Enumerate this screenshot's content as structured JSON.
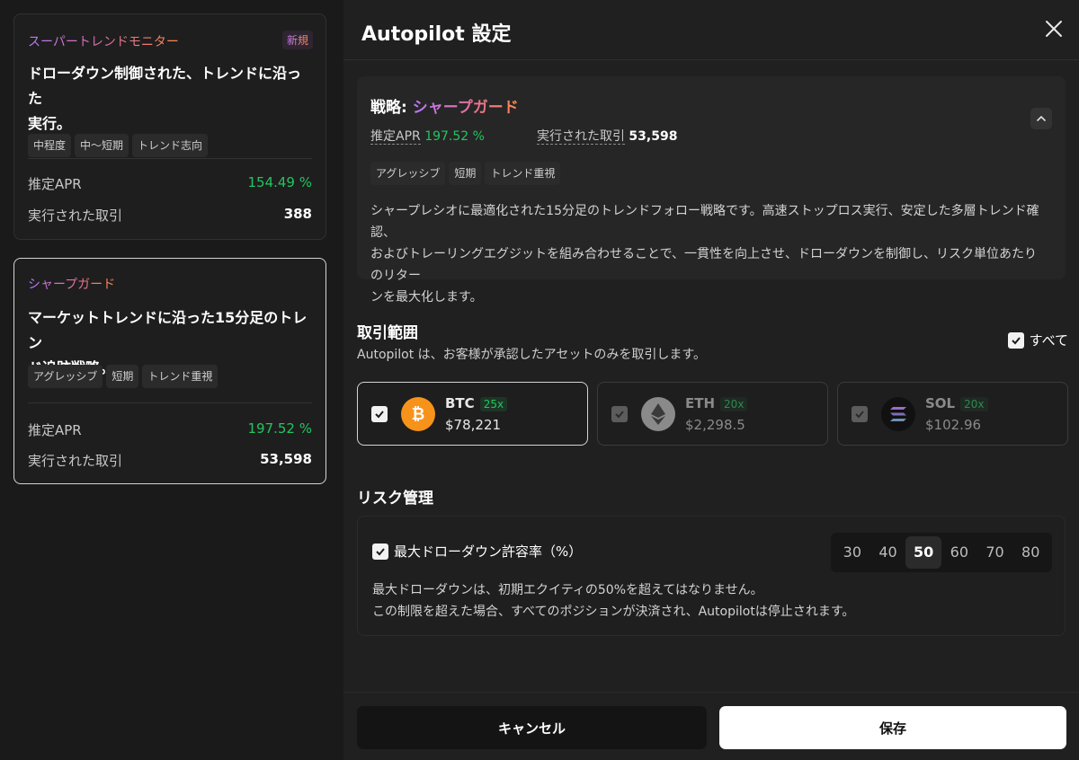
{
  "cards": [
    {
      "name": "スーパートレンドモニター",
      "badge": "新規",
      "desc_line1": "ドローダウン制御された、トレンドに沿った",
      "desc_line2": "実行。",
      "tags": [
        "中程度",
        "中〜短期",
        "トレンド志向"
      ],
      "apr_label": "推定APR",
      "apr_value": "154.49 %",
      "trades_label": "実行された取引",
      "trades_value": "388"
    },
    {
      "name": "シャープガード",
      "desc_line1": "マーケットトレンドに沿った15分足のトレン",
      "desc_line2": "ド追跡戦略。",
      "tags": [
        "アグレッシブ",
        "短期",
        "トレンド重視"
      ],
      "apr_label": "推定APR",
      "apr_value": "197.52 %",
      "trades_label": "実行された取引",
      "trades_value": "53,598"
    }
  ],
  "panel": {
    "title": "Autopilot 設定",
    "strategy": {
      "prefix": "戦略: ",
      "name": "シャープガード",
      "apr_label": "推定APR",
      "apr_value": "197.52 %",
      "trades_label": "実行された取引",
      "trades_value": "53,598",
      "tags": [
        "アグレッシブ",
        "短期",
        "トレンド重視"
      ],
      "line1": "シャープレシオに最適化された15分足のトレンドフォロー戦略です。高速ストップロス実行、安定した多層トレンド確認、",
      "line2": "およびトレーリングエグジットを組み合わせることで、一貫性を向上させ、ドローダウンを制御し、リスク単位あたりのリター",
      "line3": "ンを最大化します。"
    },
    "scope": {
      "title": "取引範囲",
      "subtitle": "Autopilot は、お客様が承認したアセットのみを取引します。",
      "all_label": "すべて",
      "assets": [
        {
          "symbol": "BTC",
          "leverage": "25x",
          "price": "$78,221",
          "icon": "bitcoin-icon",
          "color": "#f7931a"
        },
        {
          "symbol": "ETH",
          "leverage": "20x",
          "price": "$2,298.5",
          "icon": "ethereum-icon",
          "color": "#8a8a8a"
        },
        {
          "symbol": "SOL",
          "leverage": "20x",
          "price": "$102.96",
          "icon": "solana-icon",
          "color": "#111111"
        }
      ]
    },
    "risk": {
      "title": "リスク管理",
      "check_label": "最大ドローダウン許容率（%）",
      "options": [
        "30",
        "40",
        "50",
        "60",
        "70",
        "80"
      ],
      "selected": "50",
      "line1": "最大ドローダウンは、初期エクイティの50%を超えてはなりません。",
      "line2": "この制限を超えた場合、すべてのポジションが決済され、Autopilotは停止されます。"
    },
    "cancel_label": "キャンセル",
    "save_label": "保存"
  },
  "colors": {
    "accent_green": "#22c55e",
    "gradient_start": "#b978ff",
    "gradient_end": "#ff8a4a"
  }
}
